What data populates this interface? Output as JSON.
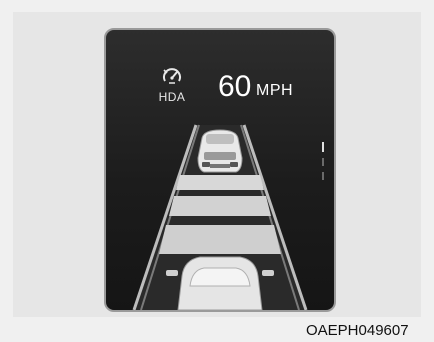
{
  "cluster": {
    "hda_label": "HDA",
    "speed_value": "60",
    "speed_unit": "MPH"
  },
  "figure": {
    "code": "OAEPH049607"
  },
  "colors": {
    "screen_bg": "#1c1c1c",
    "lane_light": "#d6d6d6",
    "road_edge": "#b5b5b5"
  },
  "icons": [
    "hda-icon",
    "lead-car-icon",
    "ego-car-icon",
    "lane-indicator-icon"
  ]
}
